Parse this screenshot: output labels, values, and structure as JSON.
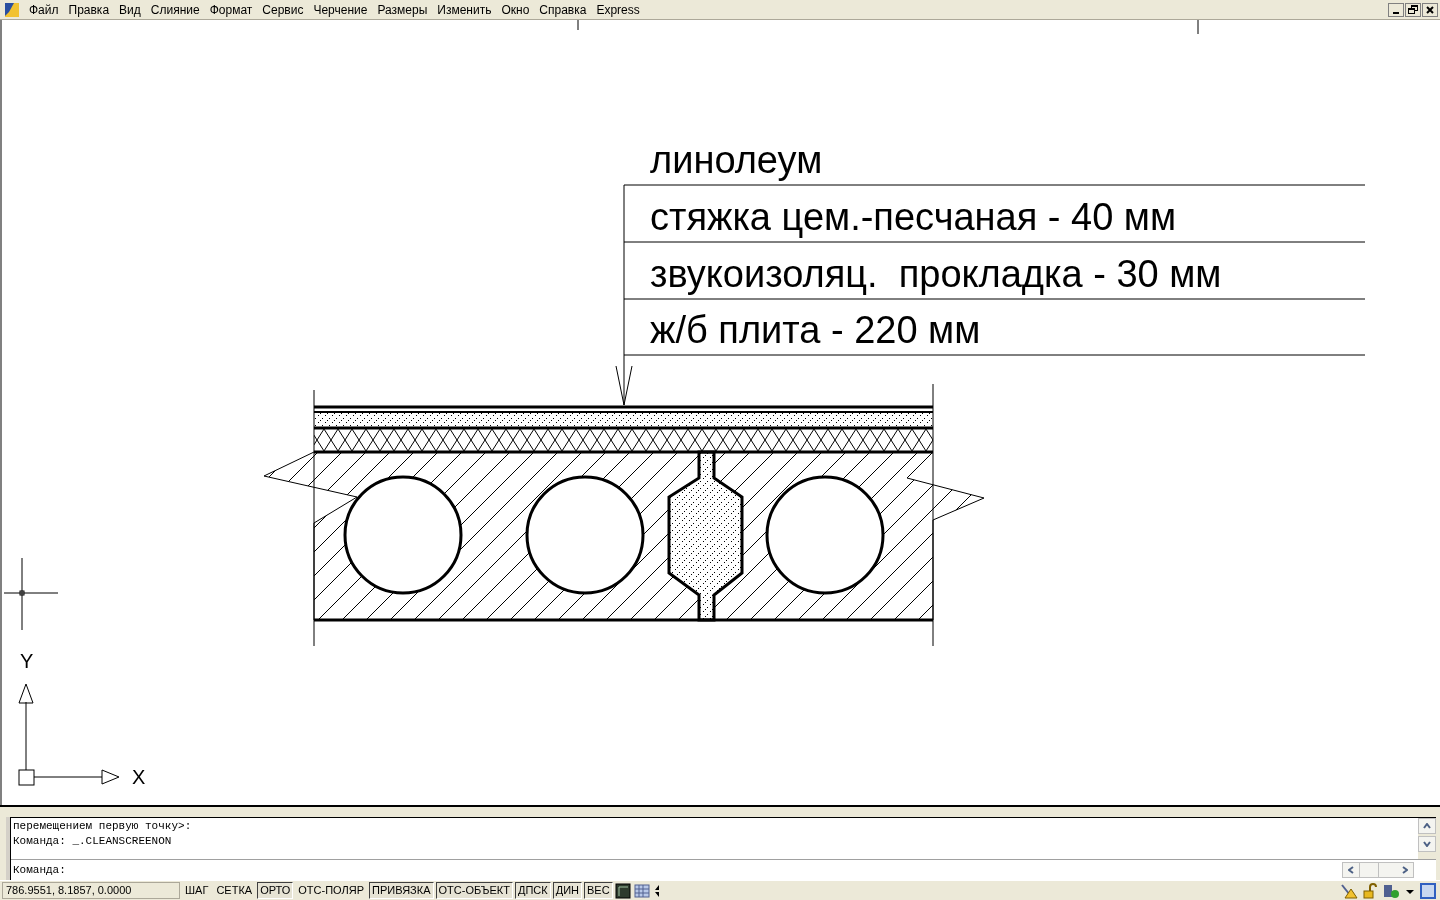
{
  "menu": [
    "Файл",
    "Правка",
    "Вид",
    "Слияние",
    "Формат",
    "Сервис",
    "Черчение",
    "Размеры",
    "Изменить",
    "Окно",
    "Справка",
    "Express"
  ],
  "drawing": {
    "labels": [
      "линолеум",
      "стяжка цем.-песчаная - 40 мм",
      "звукоизоляц.  прокладка - 30 мм",
      "ж/б плита - 220 мм"
    ]
  },
  "ucs": {
    "x_label": "X",
    "y_label": "Y"
  },
  "command_line": {
    "history": [
      "перемещением первую точку>:",
      "Команда: _.CLEANSCREENON"
    ],
    "prompt": "Команда:"
  },
  "status_bar": {
    "coordinates": "786.9551, 8.1857, 0.0000",
    "toggles": [
      {
        "label": "ШАГ",
        "on": false
      },
      {
        "label": "СЕТКА",
        "on": false
      },
      {
        "label": "ОРТО",
        "on": true
      },
      {
        "label": "ОТС-ПОЛЯР",
        "on": false
      },
      {
        "label": "ПРИВЯЗКА",
        "on": true
      },
      {
        "label": "ОТС-ОБЪЕКТ",
        "on": true
      },
      {
        "label": "ДПСК",
        "on": true
      },
      {
        "label": "ДИН",
        "on": true
      },
      {
        "label": "ВЕС",
        "on": true
      }
    ]
  }
}
